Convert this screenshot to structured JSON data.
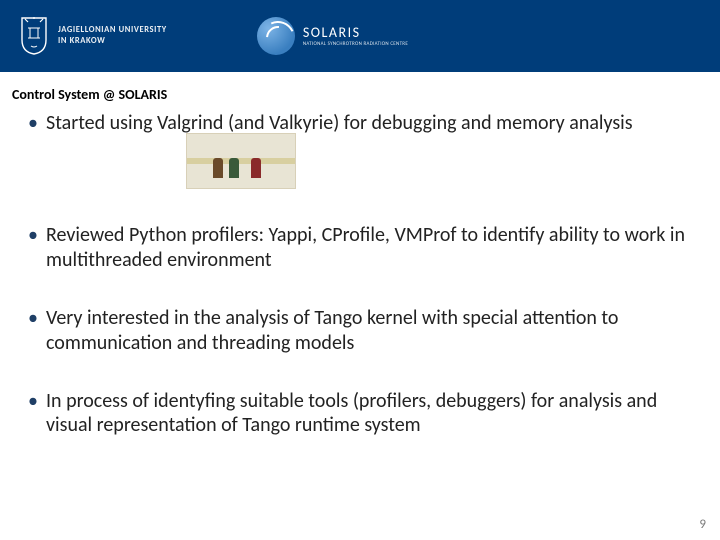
{
  "header": {
    "ju_logo_alt": "jagiellonian-crest",
    "ju_line1": "JAGIELLONIAN UNIVERSITY",
    "ju_line2": "IN KRAKOW",
    "solaris_logo_alt": "solaris-swirl",
    "solaris_name": "SOLARIS",
    "solaris_sub": "NATIONAL SYNCHROTRON RADIATION CENTRE"
  },
  "section_title": "Control System @ SOLARIS",
  "bullets": [
    "Started using Valgrind (and Valkyrie) for debugging and memory analysis",
    "Reviewed Python profilers: Yappi, CProfile, VMProf to identify ability to work in multithreaded environment",
    "Very interested in the analysis of Tango kernel with special attention to communication and threading models",
    "In process of identyfing suitable tools (profilers, debuggers) for analysis and visual representation of Tango runtime system"
  ],
  "inline_image_alt": "valkyrie-illustration",
  "page_number": "9"
}
